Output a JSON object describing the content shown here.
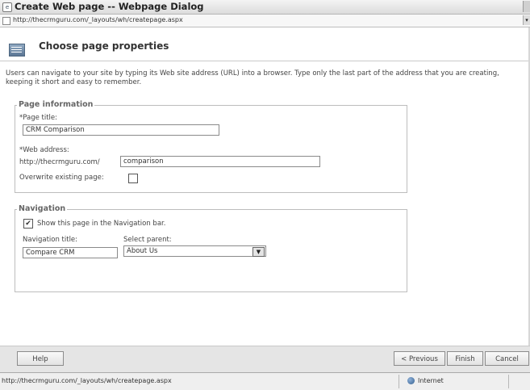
{
  "window": {
    "title": "Create Web page -- Webpage Dialog",
    "address": "http://thecrmguru.com/_layouts/wh/createpage.aspx"
  },
  "header": {
    "title": "Choose page properties"
  },
  "intro_text": "Users can navigate to your site by typing its Web site address (URL) into a browser. Type only the last part of the address that you are creating, keeping it short and easy to remember.",
  "page_info": {
    "legend": "Page information",
    "title_label": "*Page title:",
    "title_value": "CRM Comparison",
    "address_label": "*Web address:",
    "address_prefix": "http://thecrmguru.com/",
    "address_value": "comparison",
    "overwrite_label": "Overwrite existing page:",
    "overwrite_checked": false
  },
  "navigation": {
    "legend": "Navigation",
    "show_label": "Show this page in the Navigation bar.",
    "show_checked": true,
    "nav_title_label": "Navigation title:",
    "nav_title_value": "Compare CRM",
    "parent_label": "Select parent:",
    "parent_value": "About Us"
  },
  "buttons": {
    "help": "Help",
    "previous": "< Previous",
    "finish": "Finish",
    "cancel": "Cancel"
  },
  "status": {
    "url": "http://thecrmguru.com/_layouts/wh/createpage.aspx",
    "zone": "Internet"
  },
  "icons": {
    "check_mark": "✔",
    "dropdown_arrow": "▾",
    "select_arrow": "▼"
  }
}
